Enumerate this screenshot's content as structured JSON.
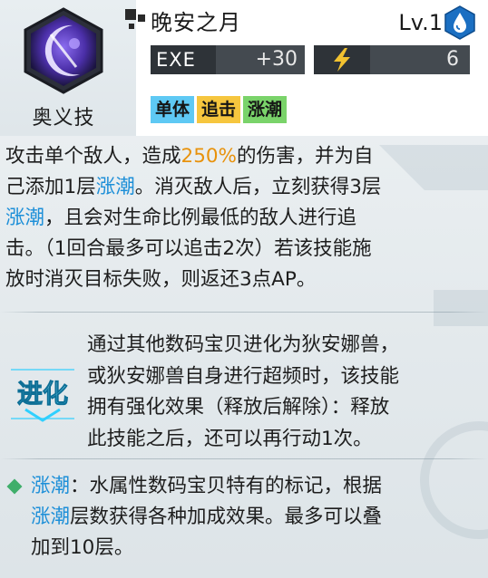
{
  "skill": {
    "name": "晚安之月",
    "type": "奥义技",
    "level": "Lv.1",
    "element_icon": "water-drop-icon",
    "skill_icon": "crescent-moon-icon"
  },
  "stats": {
    "exe_label": "EXE",
    "exe_value": "+30",
    "ap_icon": "lightning-icon",
    "ap_value": "6"
  },
  "tags": [
    {
      "label": "单体",
      "color": "#5ec9f4"
    },
    {
      "label": "追击",
      "color": "#f6c63e"
    },
    {
      "label": "涨潮",
      "color": "#7ad36a"
    }
  ],
  "description": {
    "l1_a": "攻击单个敌人，造成",
    "l1_b": "250%",
    "l1_c": "的伤害，并为自",
    "l2_a": "己添加1层",
    "l2_b": "涨潮",
    "l2_c": "。消灭敌人后，立刻获得3层",
    "l3_a": "涨潮",
    "l3_b": "，且会对生命比例最低的敌人进行追",
    "l4": "击。（1回合最多可以追击2次）若该技能施",
    "l5": "放时消灭目标失败，则返还3点AP。"
  },
  "evolution": {
    "badge_label": "进化",
    "l1": "通过其他数码宝贝进化为狄安娜兽，",
    "l2": "或狄安娜兽自身进行超频时，该技能",
    "l3": "拥有强化效果（释放后解除）：释放",
    "l4": "此技能之后，还可以再行动1次。"
  },
  "note": {
    "l1_a": "涨潮",
    "l1_b": "：水属性数码宝贝特有的标记，根据",
    "l2_a": "涨潮",
    "l2_b": "层数获得各种加成效果。最多可以叠",
    "l3": "加到10层。"
  },
  "colors": {
    "highlight_orange": "#e8920c",
    "highlight_blue": "#1d8fd8",
    "evolution_cyan": "#2fd0ff",
    "note_bullet": "#3fae6a"
  }
}
